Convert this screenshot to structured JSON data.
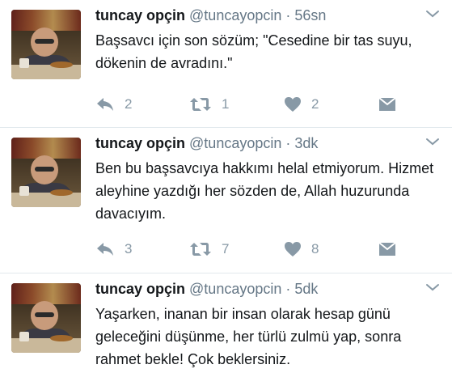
{
  "tweets": [
    {
      "name": "tuncay opçin",
      "handle": "@tuncayopcin",
      "separator": "·",
      "time": "56sn",
      "text": "Başsavcı için son sözüm; \"Cesedine bir tas suyu, dökenin de avradını.\"",
      "replies": "2",
      "retweets": "1",
      "likes": "2"
    },
    {
      "name": "tuncay opçin",
      "handle": "@tuncayopcin",
      "separator": "·",
      "time": "3dk",
      "text": "Ben bu başsavcıya hakkımı helal etmiyorum. Hizmet aleyhine yazdığı her sözden de, Allah huzurunda davacıyım.",
      "replies": "3",
      "retweets": "7",
      "likes": "8"
    },
    {
      "name": "tuncay opçin",
      "handle": "@tuncayopcin",
      "separator": "·",
      "time": "5dk",
      "text": "Yaşarken, inanan bir insan olarak hesap günü geleceğini düşünme, her türlü zulmü yap, sonra rahmet bekle! Çok beklersiniz."
    }
  ],
  "icons": {
    "reply": "reply-icon",
    "retweet": "retweet-icon",
    "like": "heart-icon",
    "message": "envelope-icon",
    "menu": "chevron-down-icon"
  },
  "colors": {
    "name": "#14171a",
    "meta": "#657786",
    "action": "#8899a6",
    "divider": "#e1e8ed"
  }
}
